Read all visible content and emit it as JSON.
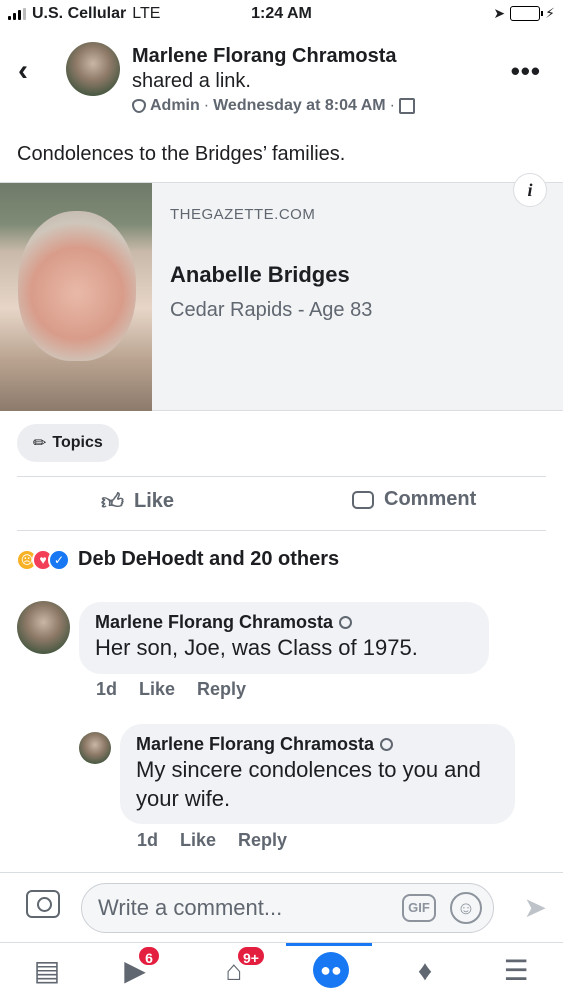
{
  "status_bar": {
    "carrier": "U.S. Cellular",
    "network": "LTE",
    "time": "1:24 AM"
  },
  "post": {
    "author": "Marlene Florang Chramosta",
    "action": "shared a link.",
    "role": "Admin",
    "timestamp": "Wednesday at 8:04 AM",
    "separator": "·",
    "text": "Condolences to the Bridges’ families.",
    "link": {
      "domain": "THEGAZETTE.COM",
      "title": "Anabelle Bridges",
      "description": "Cedar Rapids - Age 83"
    },
    "topics_label": "Topics",
    "like_label": "Like",
    "comment_label": "Comment",
    "reactions_summary": "Deb DeHoedt and 20 others"
  },
  "comments": [
    {
      "author": "Marlene Florang Chramosta",
      "text": "Her son, Joe, was Class of 1975.",
      "age": "1d",
      "like_label": "Like",
      "reply_label": "Reply"
    },
    {
      "author": "Marlene Florang Chramosta",
      "text": "My sincere condolences to you and your wife.",
      "age": "1d",
      "like_label": "Like",
      "reply_label": "Reply"
    }
  ],
  "composer": {
    "placeholder": "Write a comment...",
    "gif_label": "GIF"
  },
  "bottom_nav": {
    "video_badge": "6",
    "marketplace_badge": "9+"
  },
  "icons": {
    "back": "chevron-left-icon",
    "more": "more-horizontal-icon",
    "info": "info-icon",
    "camera": "camera-icon",
    "send": "send-icon"
  }
}
